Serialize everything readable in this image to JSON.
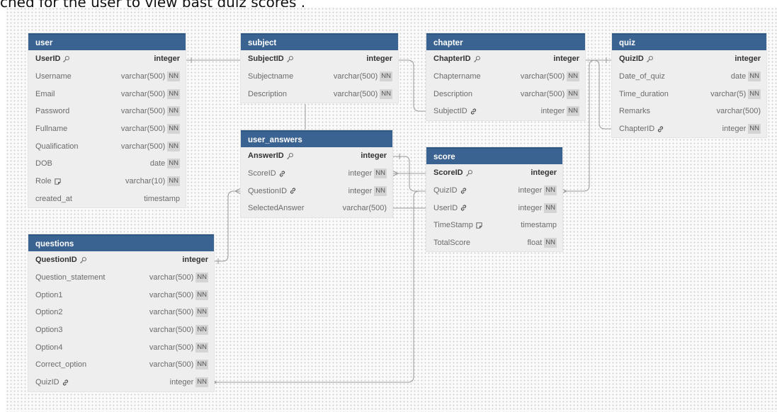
{
  "caption": "ched for the user to view past quiz scores .",
  "tables": {
    "user": {
      "name": "user",
      "fields": [
        {
          "name": "UserID",
          "type": "integer",
          "nn": "",
          "icon": "key-icon"
        },
        {
          "name": "Username",
          "type": "varchar(500)",
          "nn": "NN",
          "icon": ""
        },
        {
          "name": "Email",
          "type": "varchar(500)",
          "nn": "NN",
          "icon": ""
        },
        {
          "name": "Password",
          "type": "varchar(500)",
          "nn": "NN",
          "icon": ""
        },
        {
          "name": "Fullname",
          "type": "varchar(500)",
          "nn": "NN",
          "icon": ""
        },
        {
          "name": "Qualification",
          "type": "varchar(500)",
          "nn": "NN",
          "icon": ""
        },
        {
          "name": "DOB",
          "type": "date",
          "nn": "NN",
          "icon": ""
        },
        {
          "name": "Role",
          "type": "varchar(10)",
          "nn": "NN",
          "icon": "note-icon"
        },
        {
          "name": "created_at",
          "type": "timestamp",
          "nn": "",
          "icon": ""
        }
      ]
    },
    "subject": {
      "name": "subject",
      "fields": [
        {
          "name": "SubjectID",
          "type": "integer",
          "nn": "",
          "icon": "key-icon"
        },
        {
          "name": "Subjectname",
          "type": "varchar(500)",
          "nn": "NN",
          "icon": ""
        },
        {
          "name": "Description",
          "type": "varchar(500)",
          "nn": "NN",
          "icon": ""
        }
      ]
    },
    "chapter": {
      "name": "chapter",
      "fields": [
        {
          "name": "ChapterID",
          "type": "integer",
          "nn": "",
          "icon": "key-icon"
        },
        {
          "name": "Chaptername",
          "type": "varchar(500)",
          "nn": "NN",
          "icon": ""
        },
        {
          "name": "Description",
          "type": "varchar(500)",
          "nn": "NN",
          "icon": ""
        },
        {
          "name": "SubjectID",
          "type": "integer",
          "nn": "NN",
          "icon": "link-icon"
        }
      ]
    },
    "quiz": {
      "name": "quiz",
      "fields": [
        {
          "name": "QuizID",
          "type": "integer",
          "nn": "",
          "icon": "key-icon"
        },
        {
          "name": "Date_of_quiz",
          "type": "date",
          "nn": "NN",
          "icon": ""
        },
        {
          "name": "Time_duration",
          "type": "varchar(5)",
          "nn": "NN",
          "icon": ""
        },
        {
          "name": "Remarks",
          "type": "varchar(500)",
          "nn": "",
          "icon": ""
        },
        {
          "name": "ChapterID",
          "type": "integer",
          "nn": "NN",
          "icon": "link-icon"
        }
      ]
    },
    "user_answers": {
      "name": "user_answers",
      "fields": [
        {
          "name": "AnswerID",
          "type": "integer",
          "nn": "",
          "icon": "key-icon"
        },
        {
          "name": "ScoreID",
          "type": "integer",
          "nn": "NN",
          "icon": "link-icon"
        },
        {
          "name": "QuestionID",
          "type": "integer",
          "nn": "NN",
          "icon": "link-icon"
        },
        {
          "name": "SelectedAnswer",
          "type": "varchar(500)",
          "nn": "",
          "icon": ""
        }
      ]
    },
    "score": {
      "name": "score",
      "fields": [
        {
          "name": "ScoreID",
          "type": "integer",
          "nn": "",
          "icon": "key-icon"
        },
        {
          "name": "QuizID",
          "type": "integer",
          "nn": "NN",
          "icon": "link-icon"
        },
        {
          "name": "UserID",
          "type": "integer",
          "nn": "NN",
          "icon": "link-icon"
        },
        {
          "name": "TimeStamp",
          "type": "timestamp",
          "nn": "",
          "icon": "note-icon"
        },
        {
          "name": "TotalScore",
          "type": "float",
          "nn": "NN",
          "icon": ""
        }
      ]
    },
    "questions": {
      "name": "questions",
      "fields": [
        {
          "name": "QuestionID",
          "type": "integer",
          "nn": "",
          "icon": "key-icon"
        },
        {
          "name": "Question_statement",
          "type": "varchar(500)",
          "nn": "NN",
          "icon": ""
        },
        {
          "name": "Option1",
          "type": "varchar(500)",
          "nn": "NN",
          "icon": ""
        },
        {
          "name": "Option2",
          "type": "varchar(500)",
          "nn": "NN",
          "icon": ""
        },
        {
          "name": "Option3",
          "type": "varchar(500)",
          "nn": "NN",
          "icon": ""
        },
        {
          "name": "Option4",
          "type": "varchar(500)",
          "nn": "NN",
          "icon": ""
        },
        {
          "name": "Correct_option",
          "type": "varchar(500)",
          "nn": "NN",
          "icon": ""
        },
        {
          "name": "QuizID",
          "type": "integer",
          "nn": "NN",
          "icon": "link-icon"
        }
      ]
    }
  }
}
